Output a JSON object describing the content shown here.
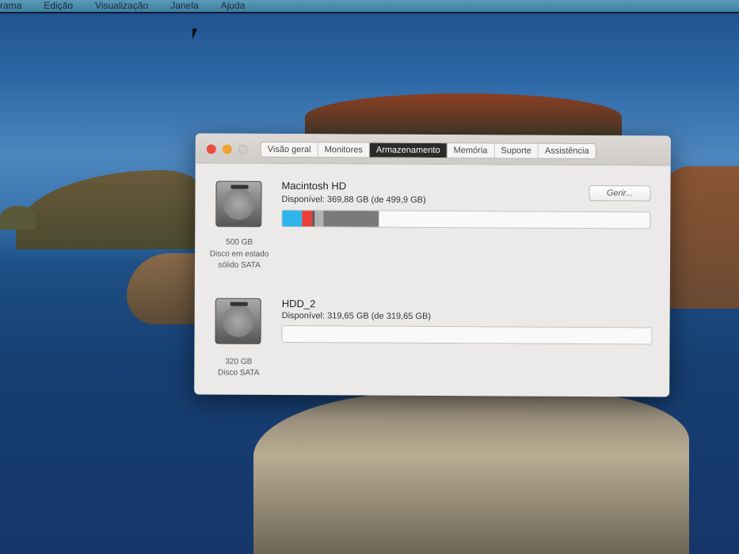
{
  "menubar": {
    "items": [
      "rama",
      "Edição",
      "Visualização",
      "Janela",
      "Ajuda"
    ]
  },
  "window": {
    "tabs": [
      {
        "label": "Visão geral"
      },
      {
        "label": "Monitores"
      },
      {
        "label": "Armazenamento",
        "active": true
      },
      {
        "label": "Memória"
      },
      {
        "label": "Suporte"
      },
      {
        "label": "Assistência"
      }
    ],
    "manage_button": "Gerir...",
    "disks": [
      {
        "name": "Macintosh HD",
        "available": "Disponível: 369,88 GB (de 499,9 GB)",
        "size": "500 GB",
        "type_line1": "Disco em estado",
        "type_line2": "sólido SATA",
        "usage_segments": [
          {
            "color": "#2eb4ea",
            "percent": 5.4
          },
          {
            "color": "#e8403c",
            "percent": 2.8
          },
          {
            "color": "#555555",
            "percent": 0.6
          },
          {
            "color": "#b0b0b0",
            "percent": 2.4
          },
          {
            "color": "#7a7a7a",
            "percent": 15.2
          }
        ]
      },
      {
        "name": "HDD_2",
        "available": "Disponível: 319,65 GB (de 319,65 GB)",
        "size": "320 GB",
        "type_line1": "Disco SATA",
        "usage_segments": []
      }
    ]
  }
}
